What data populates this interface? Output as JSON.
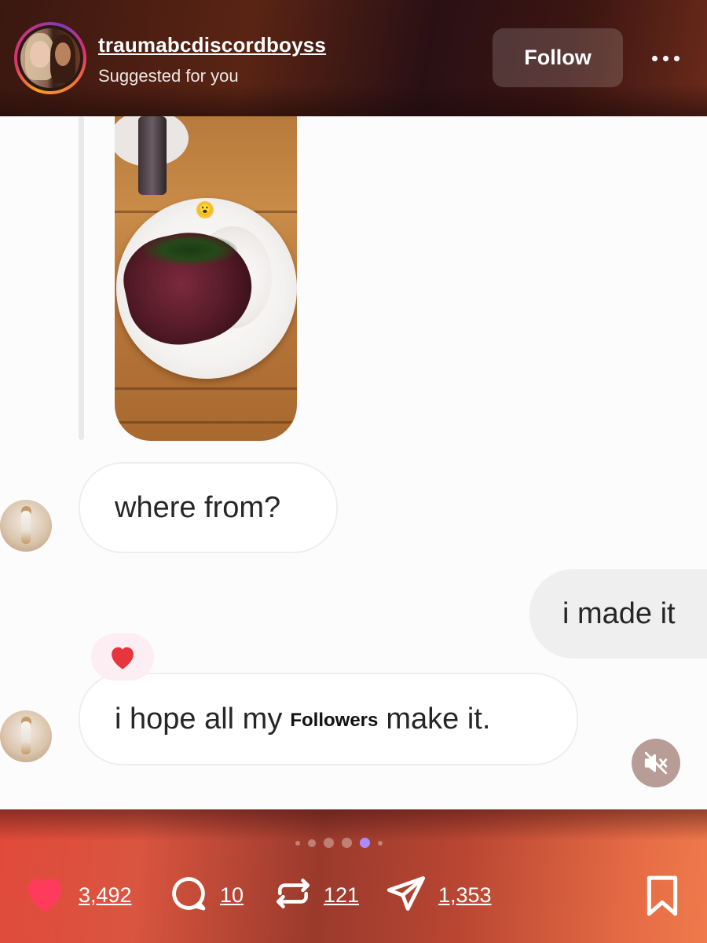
{
  "header": {
    "username": "traumabcdiscordboyss",
    "subtitle": "Suggested for you",
    "follow_label": "Follow"
  },
  "chat": {
    "messages": [
      {
        "side": "incoming",
        "text": "where from?"
      },
      {
        "side": "outgoing",
        "text": "i made it"
      },
      {
        "side": "incoming",
        "text_before": "i hope all my",
        "text_inline": "Followers",
        "text_after": "make it.",
        "reaction": "heart"
      }
    ]
  },
  "carousel": {
    "count": 6,
    "active_index": 4
  },
  "actions": {
    "likes": "3,492",
    "comments": "10",
    "reposts": "121",
    "shares": "1,353"
  },
  "icons": {
    "like": "heart-icon",
    "comment": "comment-icon",
    "repost": "repost-icon",
    "share": "send-icon",
    "save": "bookmark-icon",
    "mute": "muted-speaker-icon",
    "more": "more-dots-icon"
  },
  "colors": {
    "like_active": "#ff3b5c",
    "reaction_heart": "#e8343c",
    "carousel_active": "#a98bff"
  }
}
